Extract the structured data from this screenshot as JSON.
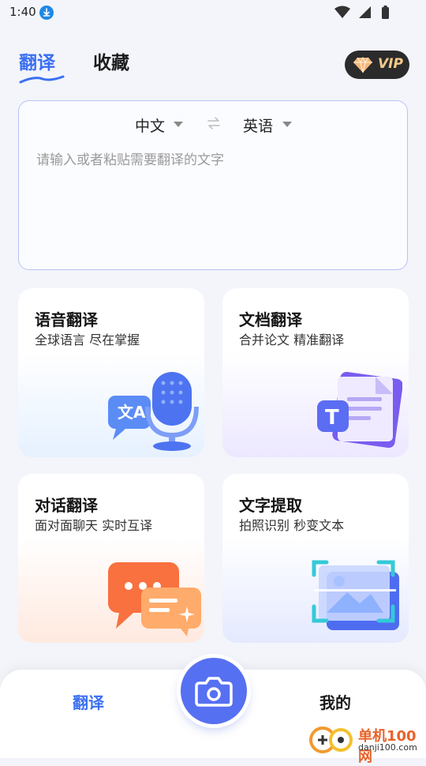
{
  "status_bar": {
    "time": "1:40"
  },
  "header": {
    "tabs": [
      {
        "label": "翻译",
        "active": true
      },
      {
        "label": "收藏",
        "active": false
      }
    ],
    "vip_label": "VIP"
  },
  "translator": {
    "source_lang": "中文",
    "target_lang": "英语",
    "placeholder": "请输入或者粘贴需要翻译的文字"
  },
  "features": [
    {
      "title": "语音翻译",
      "subtitle": "全球语言 尽在掌握",
      "icon": "microphone-icon"
    },
    {
      "title": "文档翻译",
      "subtitle": "合并论文 精准翻译",
      "icon": "document-icon"
    },
    {
      "title": "对话翻译",
      "subtitle": "面对面聊天 实时互译",
      "icon": "chat-bubbles-icon"
    },
    {
      "title": "文字提取",
      "subtitle": "拍照识别 秒变文本",
      "icon": "image-scan-icon"
    }
  ],
  "bottom_nav": {
    "left_label": "翻译",
    "right_label": "我的",
    "center_icon": "camera-icon"
  },
  "watermark": {
    "name": "单机100网",
    "url": "danji100.com"
  },
  "colors": {
    "accent": "#3b6ff3",
    "camera": "#5670f2",
    "vip_bg": "#2b2b2b",
    "vip_text": "#f5c98a"
  }
}
